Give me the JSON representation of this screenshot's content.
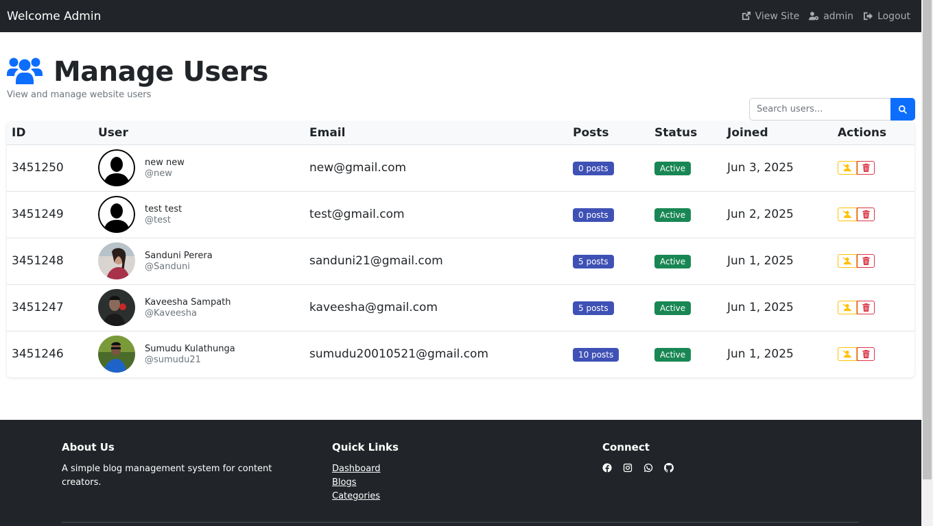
{
  "navbar": {
    "brand": "Welcome Admin",
    "links": [
      {
        "label": "View Site",
        "icon": "external-link-icon"
      },
      {
        "label": "admin",
        "icon": "user-gear-icon"
      },
      {
        "label": "Logout",
        "icon": "sign-out-icon"
      }
    ]
  },
  "header": {
    "title": "Manage Users",
    "subtitle": "View and manage website users",
    "icon": "users-icon"
  },
  "search": {
    "placeholder": "Search users...",
    "value": ""
  },
  "table": {
    "columns": [
      "ID",
      "User",
      "Email",
      "Posts",
      "Status",
      "Joined",
      "Actions"
    ],
    "rows": [
      {
        "id": "3451250",
        "name": "new new",
        "handle": "@new",
        "email": "new@gmail.com",
        "posts": "0 posts",
        "status": "Active",
        "joined": "Jun 3, 2025",
        "avatar": "default-silhouette"
      },
      {
        "id": "3451249",
        "name": "test test",
        "handle": "@test",
        "email": "test@gmail.com",
        "posts": "0 posts",
        "status": "Active",
        "joined": "Jun 2, 2025",
        "avatar": "default-silhouette"
      },
      {
        "id": "3451248",
        "name": "Sanduni Perera",
        "handle": "@Sanduni",
        "email": "sanduni21@gmail.com",
        "posts": "5 posts",
        "status": "Active",
        "joined": "Jun 1, 2025",
        "avatar": "photo"
      },
      {
        "id": "3451247",
        "name": "Kaveesha Sampath",
        "handle": "@Kaveesha",
        "email": "kaveesha@gmail.com",
        "posts": "5 posts",
        "status": "Active",
        "joined": "Jun 1, 2025",
        "avatar": "photo"
      },
      {
        "id": "3451246",
        "name": "Sumudu Kulathunga",
        "handle": "@sumudu21",
        "email": "sumudu20010521@gmail.com",
        "posts": "10 posts",
        "status": "Active",
        "joined": "Jun 1, 2025",
        "avatar": "photo"
      }
    ]
  },
  "footer": {
    "about": {
      "title": "About Us",
      "text": "A simple blog management system for content creators."
    },
    "quick_links": {
      "title": "Quick Links",
      "items": [
        "Dashboard",
        "Blogs",
        "Categories"
      ]
    },
    "connect": {
      "title": "Connect",
      "icons": [
        "facebook-icon",
        "instagram-icon",
        "whatsapp-icon",
        "github-icon"
      ]
    }
  },
  "colors": {
    "primary": "#0d6efd",
    "navbar_bg": "#212529",
    "posts_badge": "#3f51b5",
    "status_badge": "#198754",
    "warning": "#ffc107",
    "danger": "#dc3545"
  }
}
